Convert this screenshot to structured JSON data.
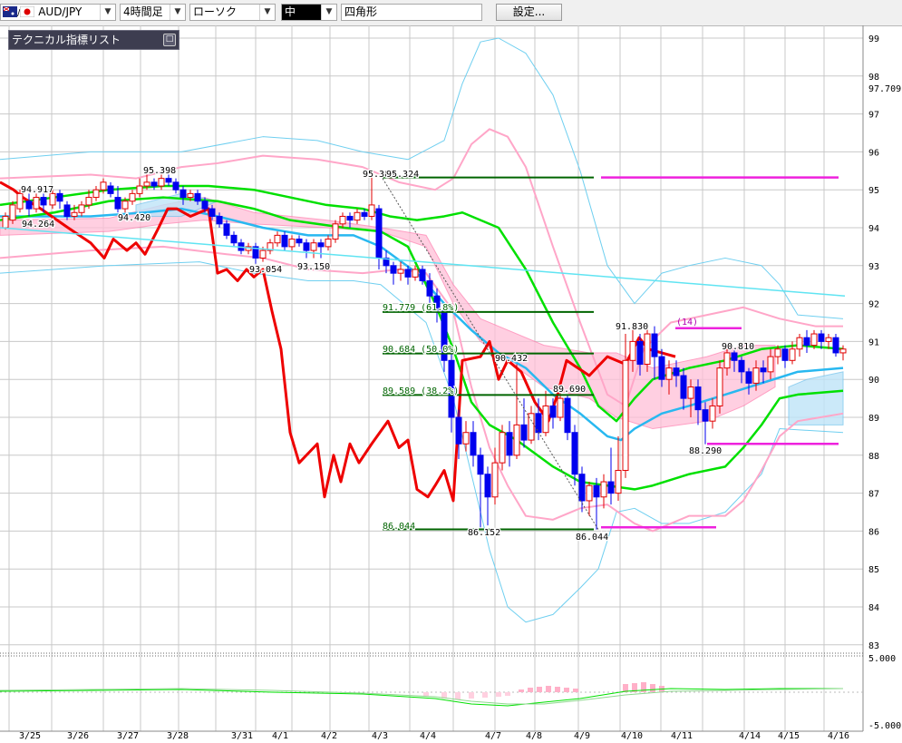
{
  "toolbar": {
    "symbol": "AUD/JPY",
    "timeframe": "4時間足",
    "chart_type": "ローソク",
    "color_label": "中",
    "shape": "四角形",
    "settings_button": "設定..."
  },
  "indicator_panel": {
    "title": "テクニカル指標リスト",
    "min_label": "□"
  },
  "colors": {
    "bull": "#e00000",
    "bear": "#0000ee",
    "ma_green": "#00e000",
    "lagging": "#ee0000",
    "bb_outer": "#6fcff0",
    "bb_inner": "#ffa6c8",
    "ma_cyan": "#28b8f0",
    "fib": "#006400",
    "magenta": "#ee22dd",
    "grid": "#c8c8c8"
  },
  "chart_data": {
    "type": "candlestick",
    "y_ticks": [
      "99",
      "98",
      "97",
      "96",
      "95",
      "94",
      "93",
      "92",
      "91",
      "90",
      "89",
      "88",
      "87",
      "86",
      "85",
      "84",
      "83"
    ],
    "current_price": "97.709",
    "osc_ticks": [
      "5.000",
      "-5.000"
    ],
    "x_labels": [
      "3/25",
      "3/26",
      "3/27",
      "3/28",
      "3/31",
      "4/1",
      "4/2",
      "4/3",
      "4/4",
      "4/7",
      "4/8",
      "4/9",
      "4/10",
      "4/11",
      "4/14",
      "4/15",
      "4/16"
    ],
    "price_labels": [
      "94.917",
      "94.264",
      "94.420",
      "95.398",
      "93.054",
      "93.150",
      "95.384",
      "95.324",
      "91.830",
      "90.810",
      "89.690",
      "90.432",
      "86.044",
      "86.152",
      "88.290"
    ],
    "fib_labels": [
      "91.779 (61.8%)",
      "90.684 (50.0%)",
      "89.589 (38.2%)",
      "86.044"
    ],
    "annotation": "(14)"
  }
}
